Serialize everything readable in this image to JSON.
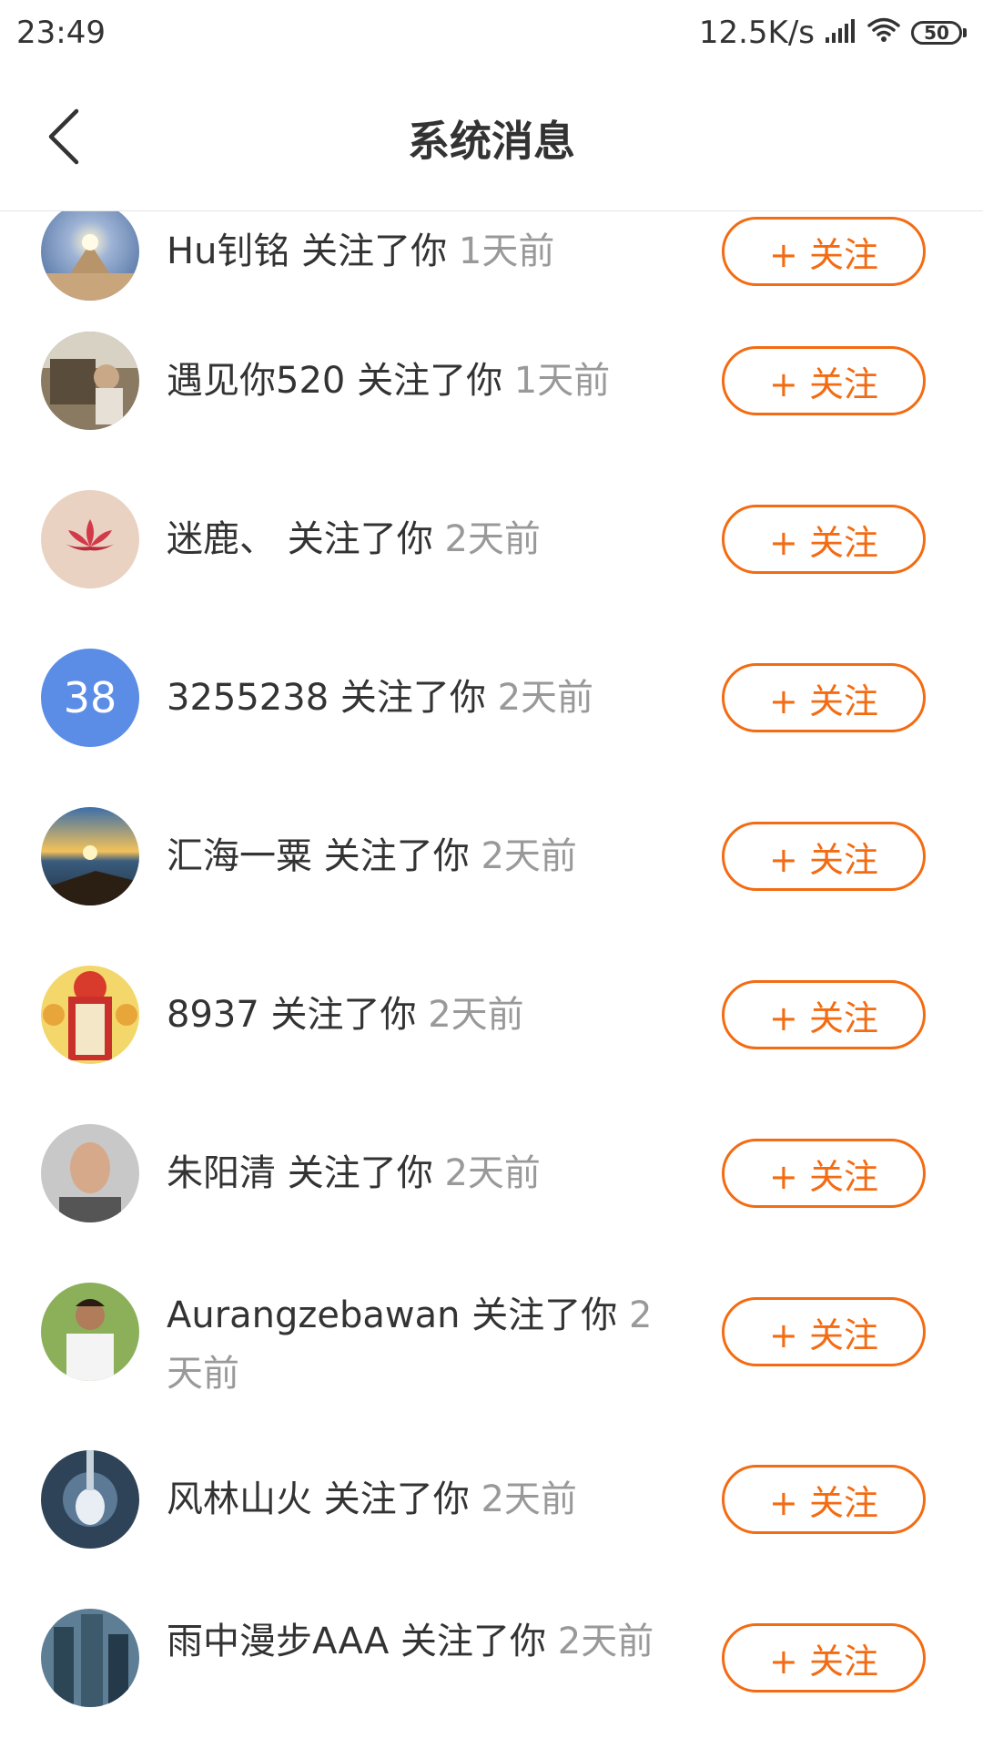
{
  "status_bar": {
    "time": "23:49",
    "net_speed": "12.5K/s",
    "battery": "50"
  },
  "header": {
    "title": "系统消息"
  },
  "colors": {
    "accent": "#f36b12",
    "secondary_text": "#999999",
    "primary_text": "#333333"
  },
  "messages": [
    {
      "user": "Hu钊铭",
      "action": "关注了你",
      "time": "1天前",
      "button": "+ 关注"
    },
    {
      "user": "遇见你520",
      "action": "关注了你",
      "time": "1天前",
      "button": "+ 关注"
    },
    {
      "user": "迷鹿、",
      "action": "关注了你",
      "time": "2天前",
      "button": "+ 关注"
    },
    {
      "user": "3255238",
      "action": "关注了你",
      "time": "2天前",
      "button": "+ 关注",
      "avatar_text": "38"
    },
    {
      "user": "汇海一粟",
      "action": "关注了你",
      "time": "2天前",
      "button": "+ 关注"
    },
    {
      "user": "8937",
      "action": "关注了你",
      "time": "2天前",
      "button": "+ 关注"
    },
    {
      "user": "朱阳清",
      "action": "关注了你",
      "time": "2天前",
      "button": "+ 关注"
    },
    {
      "user": "Aurangzebawan",
      "action": "关注了你",
      "time": "2天前",
      "button": "+ 关注"
    },
    {
      "user": "风林山火",
      "action": "关注了你",
      "time": "2天前",
      "button": "+ 关注"
    },
    {
      "user": "雨中漫步AAA",
      "action": "关注了你",
      "time": "2天前",
      "button": "+ 关注"
    }
  ]
}
